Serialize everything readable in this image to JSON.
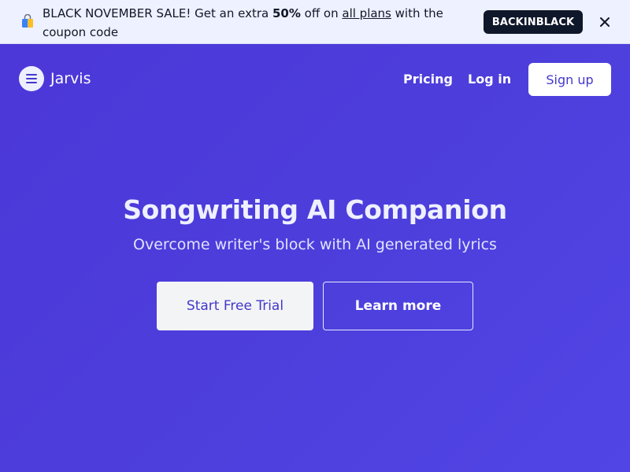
{
  "banner": {
    "icon": "shopping-bag-icon",
    "text_before": "BLACK NOVEMBER SALE! Get an extra ",
    "discount": "50%",
    "text_middle": " off on ",
    "link_text": "all plans",
    "text_after": " with the coupon code",
    "coupon_code": "BACKINBLACK",
    "close_icon": "close-icon"
  },
  "nav": {
    "menu_icon": "hamburger-menu-icon",
    "brand": "Jarvis",
    "links": [
      "Pricing",
      "Log in"
    ],
    "signup_label": "Sign up"
  },
  "hero": {
    "title": "Songwriting AI Companion",
    "subtitle": "Overcome writer's block with AI generated lyrics",
    "primary_cta": "Start Free Trial",
    "secondary_cta": "Learn more"
  },
  "colors": {
    "hero_background": "#4f3fdc",
    "banner_background": "#eef1ff",
    "coupon_background": "#0f172a",
    "accent_text": "#4338ca"
  }
}
